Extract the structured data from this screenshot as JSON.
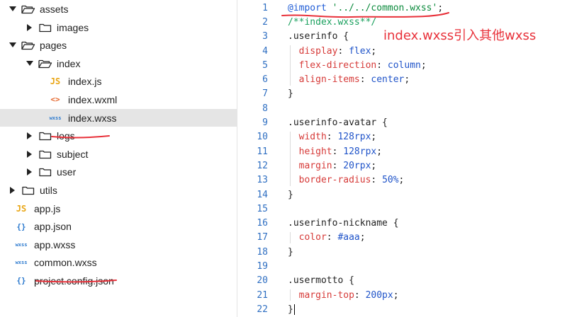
{
  "file_tree": [
    {
      "label": "assets",
      "kind": "folder",
      "expanded": true,
      "depth": 0
    },
    {
      "label": "images",
      "kind": "folder",
      "expanded": false,
      "depth": 1
    },
    {
      "label": "pages",
      "kind": "folder",
      "expanded": true,
      "depth": 0
    },
    {
      "label": "index",
      "kind": "folder",
      "expanded": true,
      "depth": 1
    },
    {
      "label": "index.js",
      "kind": "file",
      "type": "js",
      "icon_text": "JS",
      "depth": 2
    },
    {
      "label": "index.wxml",
      "kind": "file",
      "type": "xml",
      "icon_text": "<>",
      "depth": 2
    },
    {
      "label": "index.wxss",
      "kind": "file",
      "type": "wxss",
      "icon_text": "wxss",
      "depth": 2,
      "selected": true,
      "underlined": true
    },
    {
      "label": "logs",
      "kind": "folder",
      "expanded": false,
      "depth": 1
    },
    {
      "label": "subject",
      "kind": "folder",
      "expanded": false,
      "depth": 1
    },
    {
      "label": "user",
      "kind": "folder",
      "expanded": false,
      "depth": 1
    },
    {
      "label": "utils",
      "kind": "folder",
      "expanded": false,
      "depth": 0
    },
    {
      "label": "app.js",
      "kind": "file",
      "type": "js",
      "icon_text": "JS",
      "depth": 0
    },
    {
      "label": "app.json",
      "kind": "file",
      "type": "json",
      "icon_text": "{}",
      "depth": 0
    },
    {
      "label": "app.wxss",
      "kind": "file",
      "type": "wxss",
      "icon_text": "wxss",
      "depth": 0
    },
    {
      "label": "common.wxss",
      "kind": "file",
      "type": "wxss",
      "icon_text": "wxss",
      "depth": 0,
      "underlined": true
    },
    {
      "label": "project.config.json",
      "kind": "file",
      "type": "json",
      "icon_text": "{}",
      "depth": 0
    }
  ],
  "editor": {
    "lines": [
      {
        "number": "1",
        "tokens": [
          {
            "t": "@import",
            "c": "kw"
          },
          {
            "t": " ",
            "c": "sel"
          },
          {
            "t": "'../../common.wxss'",
            "c": "str"
          },
          {
            "t": ";",
            "c": "sel"
          }
        ]
      },
      {
        "number": "2",
        "tokens": [
          {
            "t": "/**index.wxss**/",
            "c": "com"
          }
        ]
      },
      {
        "number": "3",
        "tokens": [
          {
            "t": ".userinfo {",
            "c": "sel"
          }
        ]
      },
      {
        "number": "4",
        "tokens": [
          {
            "t": "  display",
            "c": "prop"
          },
          {
            "t": ": ",
            "c": "sel"
          },
          {
            "t": "flex",
            "c": "val"
          },
          {
            "t": ";",
            "c": "sel"
          }
        ]
      },
      {
        "number": "5",
        "tokens": [
          {
            "t": "  flex-direction",
            "c": "prop"
          },
          {
            "t": ": ",
            "c": "sel"
          },
          {
            "t": "column",
            "c": "val"
          },
          {
            "t": ";",
            "c": "sel"
          }
        ]
      },
      {
        "number": "6",
        "tokens": [
          {
            "t": "  align-items",
            "c": "prop"
          },
          {
            "t": ": ",
            "c": "sel"
          },
          {
            "t": "center",
            "c": "val"
          },
          {
            "t": ";",
            "c": "sel"
          }
        ]
      },
      {
        "number": "7",
        "tokens": [
          {
            "t": "}",
            "c": "sel"
          }
        ]
      },
      {
        "number": "8",
        "tokens": []
      },
      {
        "number": "9",
        "tokens": [
          {
            "t": ".userinfo-avatar {",
            "c": "sel"
          }
        ]
      },
      {
        "number": "10",
        "tokens": [
          {
            "t": "  width",
            "c": "prop"
          },
          {
            "t": ": ",
            "c": "sel"
          },
          {
            "t": "128rpx",
            "c": "num"
          },
          {
            "t": ";",
            "c": "sel"
          }
        ]
      },
      {
        "number": "11",
        "tokens": [
          {
            "t": "  height",
            "c": "prop"
          },
          {
            "t": ": ",
            "c": "sel"
          },
          {
            "t": "128rpx",
            "c": "num"
          },
          {
            "t": ";",
            "c": "sel"
          }
        ]
      },
      {
        "number": "12",
        "tokens": [
          {
            "t": "  margin",
            "c": "prop"
          },
          {
            "t": ": ",
            "c": "sel"
          },
          {
            "t": "20rpx",
            "c": "num"
          },
          {
            "t": ";",
            "c": "sel"
          }
        ]
      },
      {
        "number": "13",
        "tokens": [
          {
            "t": "  border-radius",
            "c": "prop"
          },
          {
            "t": ": ",
            "c": "sel"
          },
          {
            "t": "50%",
            "c": "num"
          },
          {
            "t": ";",
            "c": "sel"
          }
        ]
      },
      {
        "number": "14",
        "tokens": [
          {
            "t": "}",
            "c": "sel"
          }
        ]
      },
      {
        "number": "15",
        "tokens": []
      },
      {
        "number": "16",
        "tokens": [
          {
            "t": ".userinfo-nickname {",
            "c": "sel"
          }
        ]
      },
      {
        "number": "17",
        "tokens": [
          {
            "t": "  color",
            "c": "prop"
          },
          {
            "t": ": ",
            "c": "sel"
          },
          {
            "t": "#aaa",
            "c": "val"
          },
          {
            "t": ";",
            "c": "sel"
          }
        ]
      },
      {
        "number": "18",
        "tokens": [
          {
            "t": "}",
            "c": "sel"
          }
        ]
      },
      {
        "number": "19",
        "tokens": []
      },
      {
        "number": "20",
        "tokens": [
          {
            "t": ".usermotto {",
            "c": "sel"
          }
        ]
      },
      {
        "number": "21",
        "tokens": [
          {
            "t": "  margin-top",
            "c": "prop"
          },
          {
            "t": ": ",
            "c": "sel"
          },
          {
            "t": "200px",
            "c": "num"
          },
          {
            "t": ";",
            "c": "sel"
          }
        ]
      },
      {
        "number": "22",
        "tokens": [
          {
            "t": "}",
            "c": "sel"
          }
        ],
        "cursor": true
      }
    ]
  },
  "annotation": {
    "text": "index.wxss引入其他wxss",
    "color": "#e8313a"
  },
  "colors": {
    "selection_bg": "#e5e5e5",
    "line_number": "#2f6fc2",
    "annotation_red": "#e8313a"
  }
}
